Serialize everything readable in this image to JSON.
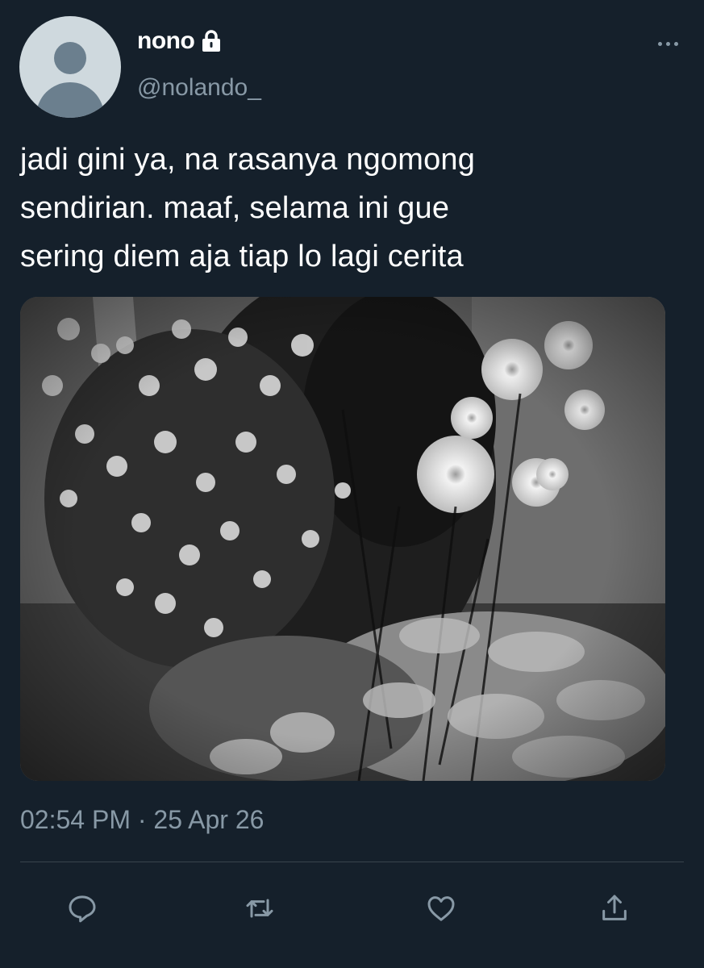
{
  "tweet": {
    "display_name": "nono",
    "handle": "@nolando_",
    "text": "jadi gini ya, na rasanya ngomong\nsendirian. maaf, selama ini gue\nsering diem aja tiap lo lagi cerita",
    "timestamp": "02:54 PM · 25 Apr 26",
    "protected": true
  },
  "icons": {
    "protected": "lock-icon",
    "more": "more-icon",
    "reply": "reply-icon",
    "retweet": "retweet-icon",
    "like": "heart-icon",
    "share": "share-icon"
  },
  "colors": {
    "background": "#15202b",
    "text": "#ffffff",
    "secondary": "#8899a6",
    "divider": "#38444d"
  }
}
